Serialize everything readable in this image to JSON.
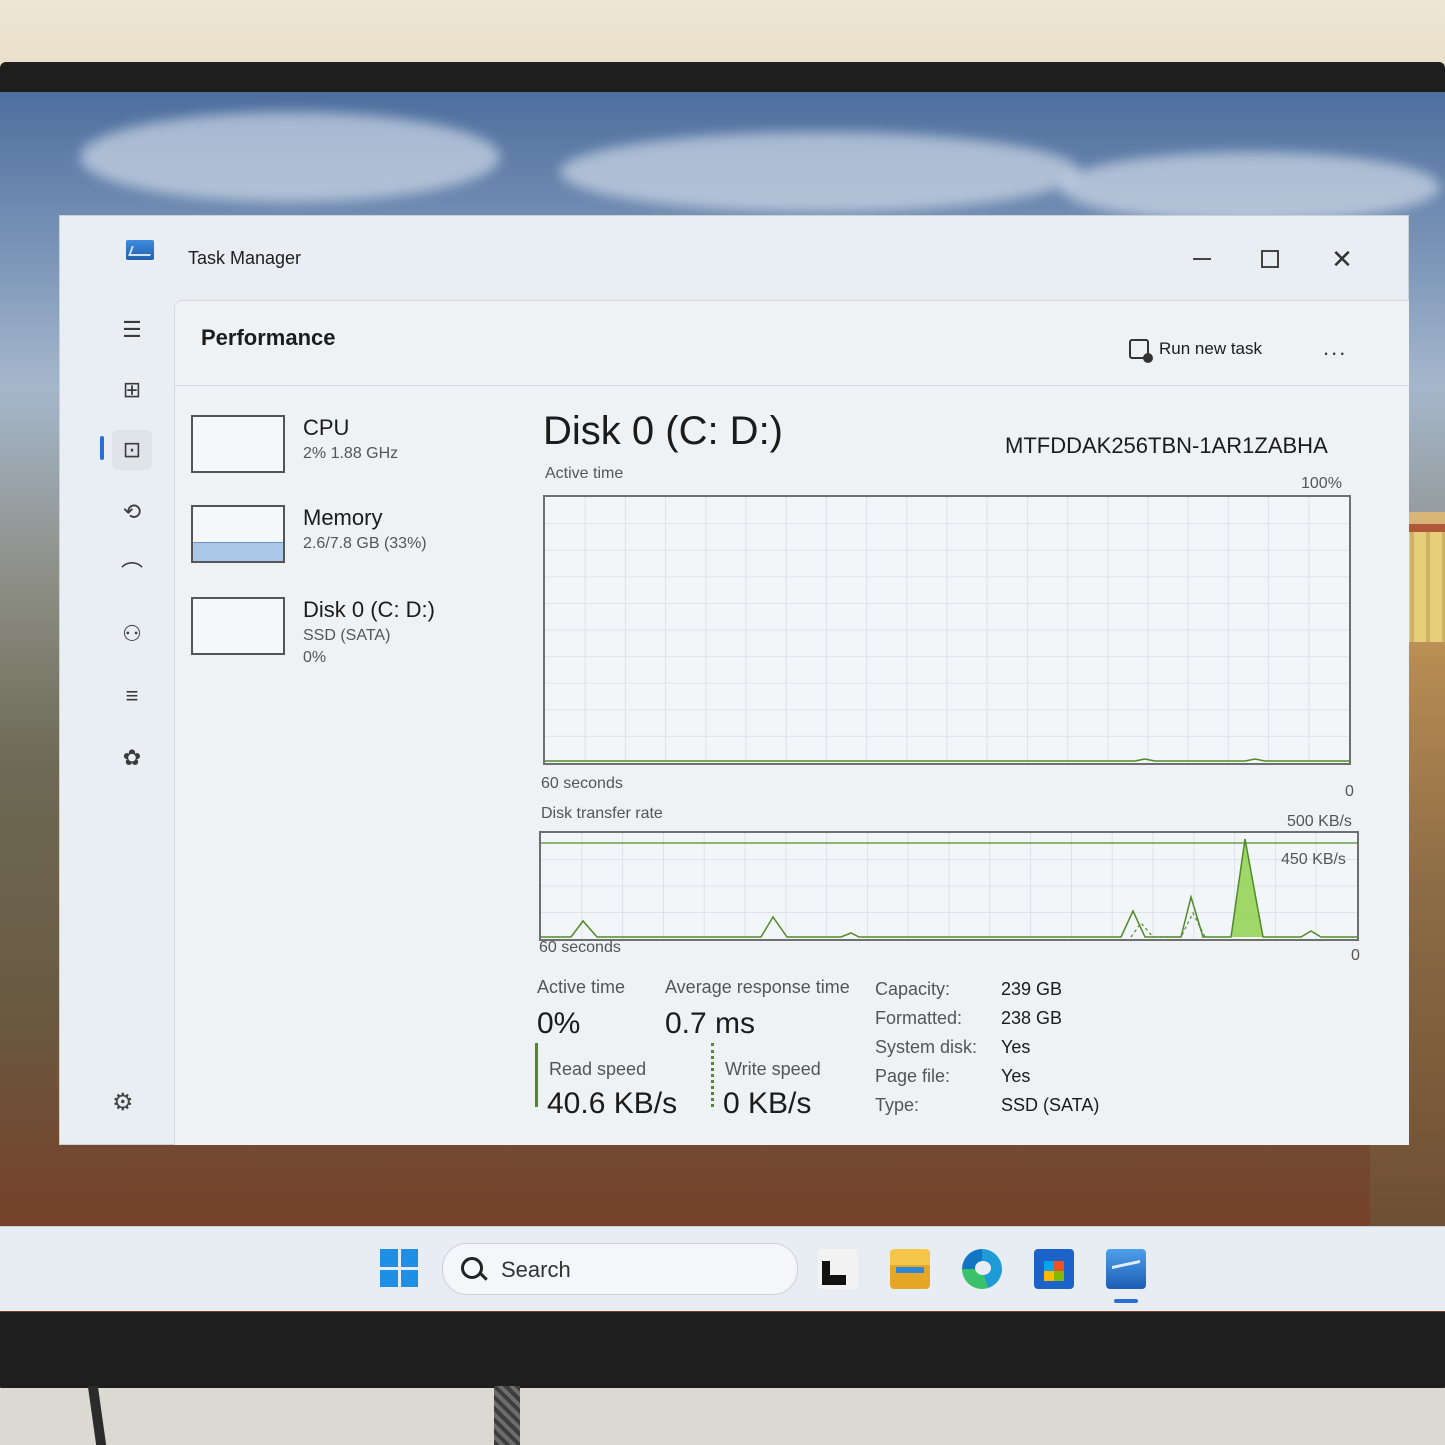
{
  "window": {
    "title": "Task Manager"
  },
  "header": {
    "page_title": "Performance",
    "run_new_task": "Run new task",
    "more": "..."
  },
  "nav": [
    "hamburger-icon",
    "processes-icon",
    "performance-icon",
    "app-history-icon",
    "startup-apps-icon",
    "users-icon",
    "details-icon",
    "services-icon",
    "settings-icon"
  ],
  "devices": [
    {
      "name": "CPU",
      "sub": "2% 1.88 GHz",
      "sub2": ""
    },
    {
      "name": "Memory",
      "sub": "2.6/7.8 GB (33%)",
      "sub2": ""
    },
    {
      "name": "Disk 0 (C: D:)",
      "sub": "SSD (SATA)",
      "sub2": "0%"
    }
  ],
  "disk": {
    "title": "Disk 0 (C: D:)",
    "model": "MTFDDAK256TBN-1AR1ZABHA",
    "active_graph": {
      "label": "Active time",
      "max_label": "100%",
      "time_label": "60 seconds",
      "min_label": "0"
    },
    "transfer_graph": {
      "label": "Disk transfer rate",
      "max_label": "500 KB/s",
      "mid_label": "450 KB/s",
      "time_label": "60 seconds",
      "min_label": "0"
    },
    "stats": {
      "active_time_label": "Active time",
      "active_time": "0%",
      "response_label": "Average response time",
      "response": "0.7 ms",
      "read_label": "Read speed",
      "read": "40.6 KB/s",
      "write_label": "Write speed",
      "write": "0 KB/s"
    },
    "properties": [
      {
        "k": "Capacity:",
        "v": "239 GB"
      },
      {
        "k": "Formatted:",
        "v": "238 GB"
      },
      {
        "k": "System disk:",
        "v": "Yes"
      },
      {
        "k": "Page file:",
        "v": "Yes"
      },
      {
        "k": "Type:",
        "v": "SSD (SATA)"
      }
    ]
  },
  "taskbar": {
    "search_placeholder": "Search"
  },
  "colors": {
    "accent": "#2b6fd6",
    "graph_line": "#4f8a2a",
    "graph_fill": "#8fd14f"
  }
}
